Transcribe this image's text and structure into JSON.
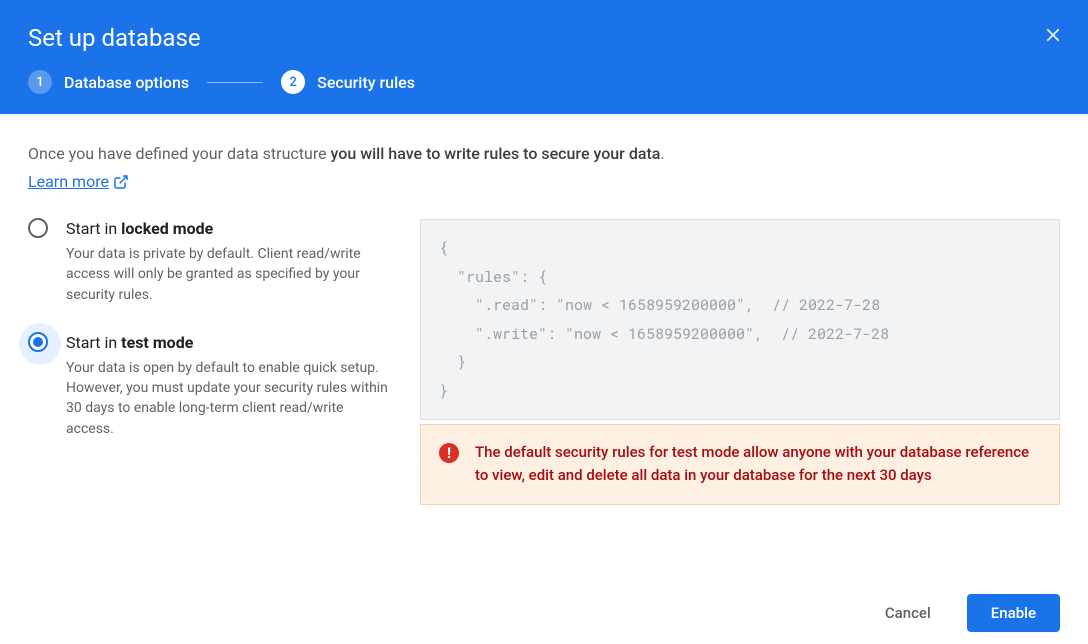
{
  "header": {
    "title": "Set up database",
    "steps": [
      {
        "num": "1",
        "label": "Database options"
      },
      {
        "num": "2",
        "label": "Security rules"
      }
    ]
  },
  "intro": {
    "prefix": "Once you have defined your data structure ",
    "bold": "you will have to write rules to secure your data",
    "suffix": ".",
    "learn_more": "Learn more"
  },
  "options": {
    "locked": {
      "title_prefix": "Start in ",
      "title_bold": "locked mode",
      "desc": "Your data is private by default. Client read/write access will only be granted as specified by your security rules."
    },
    "test": {
      "title_prefix": "Start in ",
      "title_bold": "test mode",
      "desc": "Your data is open by default to enable quick setup. However, you must update your security rules within 30 days to enable long-term client read/write access."
    }
  },
  "rules_code": "{\n  \"rules\": {\n    \".read\": \"now < 1658959200000\",  // 2022-7-28\n    \".write\": \"now < 1658959200000\",  // 2022-7-28\n  }\n}",
  "warning": {
    "icon_glyph": "!",
    "text": "The default security rules for test mode allow anyone with your database reference to view, edit and delete all data in your database for the next 30 days"
  },
  "footer": {
    "cancel": "Cancel",
    "enable": "Enable"
  }
}
